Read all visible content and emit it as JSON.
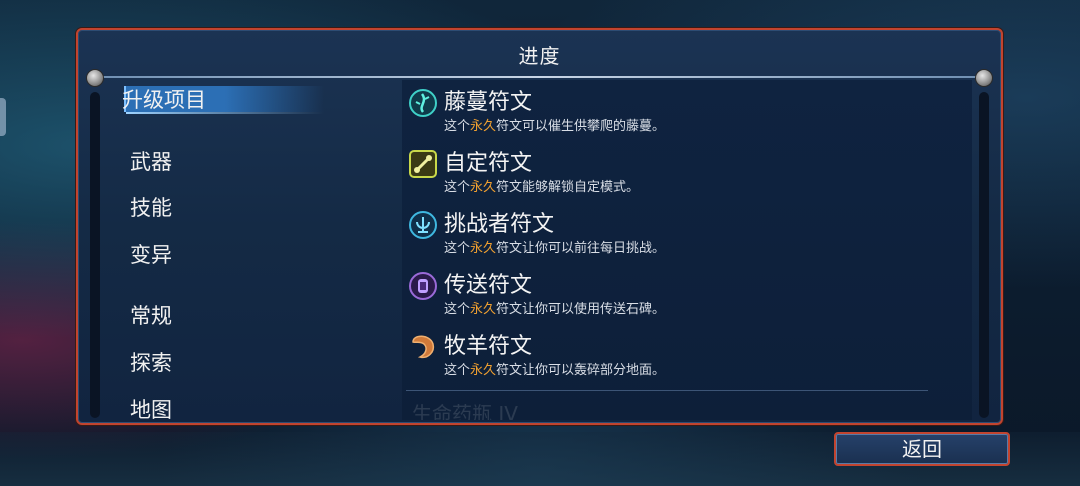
{
  "panel": {
    "title": "进度"
  },
  "categories": [
    {
      "label": "升级项目",
      "selected": true
    },
    {
      "label": "武器",
      "selected": false
    },
    {
      "label": "技能",
      "selected": false
    },
    {
      "label": "变异",
      "selected": false
    },
    {
      "label": "常规",
      "selected": false
    },
    {
      "label": "探索",
      "selected": false
    },
    {
      "label": "地图",
      "selected": false
    }
  ],
  "items": [
    {
      "name": "藤蔓符文",
      "desc_pre": "这个",
      "desc_hl": "永久",
      "desc_post": "符文可以催生供攀爬的藤蔓。",
      "icon": "vine-rune-icon",
      "color": "#3fd0c8"
    },
    {
      "name": "自定符文",
      "desc_pre": "这个",
      "desc_hl": "永久",
      "desc_post": "符文能够解锁自定模式。",
      "icon": "custom-rune-icon",
      "color": "#c8d84a"
    },
    {
      "name": "挑战者符文",
      "desc_pre": "这个",
      "desc_hl": "永久",
      "desc_post": "符文让你可以前往每日挑战。",
      "icon": "challenger-rune-icon",
      "color": "#3fb8e0"
    },
    {
      "name": "传送符文",
      "desc_pre": "这个",
      "desc_hl": "永久",
      "desc_post": "符文让你可以使用传送石碑。",
      "icon": "teleport-rune-icon",
      "color": "#9a6ad8"
    },
    {
      "name": "牧羊符文",
      "desc_pre": "这个",
      "desc_hl": "永久",
      "desc_post": "符文让你可以轰碎部分地面。",
      "icon": "ram-rune-icon",
      "color": "#d07a3a"
    }
  ],
  "faded_item": "生命药瓶 IV",
  "back_button": "返回",
  "colors": {
    "border": "#c2442f",
    "highlight": "#f0a030",
    "selected": "#2c6fb5"
  }
}
